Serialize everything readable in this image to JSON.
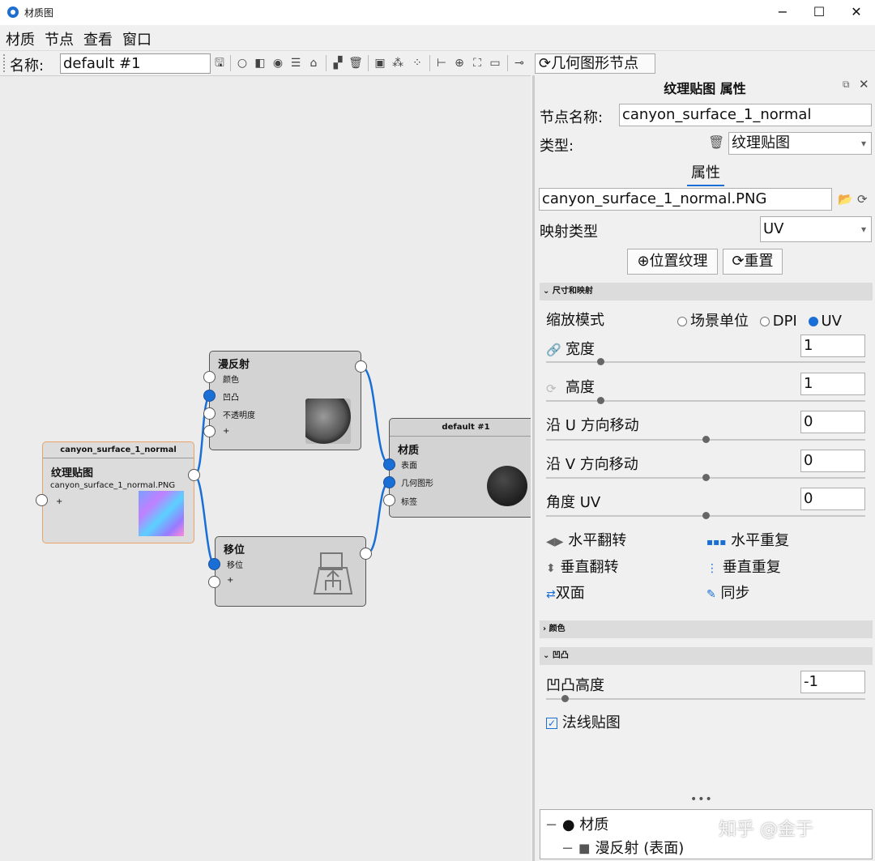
{
  "window": {
    "title": "材质图",
    "minimize": "−",
    "maximize": "☐",
    "close": "✕"
  },
  "menu": [
    "材质",
    "节点",
    "查看",
    "窗口"
  ],
  "toolbar": {
    "name_label": "名称:",
    "name_value": "default #1",
    "geometry_button": "几何图形节点"
  },
  "nodes": {
    "texture": {
      "header": "canyon_surface_1_normal",
      "title": "纹理贴图",
      "file": "canyon_surface_1_normal.PNG",
      "plus": "+"
    },
    "diffuse": {
      "title": "漫反射",
      "slots": [
        "颜色",
        "凹凸",
        "不透明度",
        "+"
      ]
    },
    "displacement": {
      "title": "移位",
      "slots": [
        "移位",
        "+"
      ]
    },
    "material": {
      "header": "default #1",
      "title": "材质",
      "slots": [
        "表面",
        "几何图形",
        "标签"
      ]
    }
  },
  "panel": {
    "title": "纹理贴图 属性",
    "node_name_label": "节点名称:",
    "node_name_value": "canyon_surface_1_normal",
    "type_label": "类型:",
    "type_value": "纹理贴图",
    "tab": "属性",
    "file_value": "canyon_surface_1_normal.PNG",
    "mapping_label": "映射类型",
    "mapping_value": "UV",
    "locate_button": "位置纹理",
    "reset_button": "重置",
    "section_size": "尺寸和映射",
    "scale_mode_label": "缩放模式",
    "scale_options": [
      "场景单位",
      "DPI",
      "UV"
    ],
    "scale_selected": "UV",
    "width_label": "宽度",
    "width_value": "1",
    "height_label": "高度",
    "height_value": "1",
    "u_move_label": "沿 U 方向移动",
    "u_move_value": "0",
    "v_move_label": "沿 V 方向移动",
    "v_move_value": "0",
    "angle_label": "角度 UV",
    "angle_value": "0",
    "flip_h": "水平翻转",
    "repeat_h": "水平重复",
    "flip_v": "垂直翻转",
    "repeat_v": "垂直重复",
    "double_sided": "双面",
    "sync": "同步",
    "section_color": "颜色",
    "section_bump": "凹凸",
    "bump_height_label": "凹凸高度",
    "bump_height_value": "-1",
    "normal_map_label": "法线贴图",
    "normal_map_checked": true,
    "more": "•••",
    "tree": [
      "材质",
      "漫反射 (表面)"
    ],
    "watermark": "知乎 @金于"
  },
  "colors": {
    "accent": "#1a6fd6",
    "node_bg": "#d3d3d3",
    "texture_border": "#e8a36a"
  }
}
